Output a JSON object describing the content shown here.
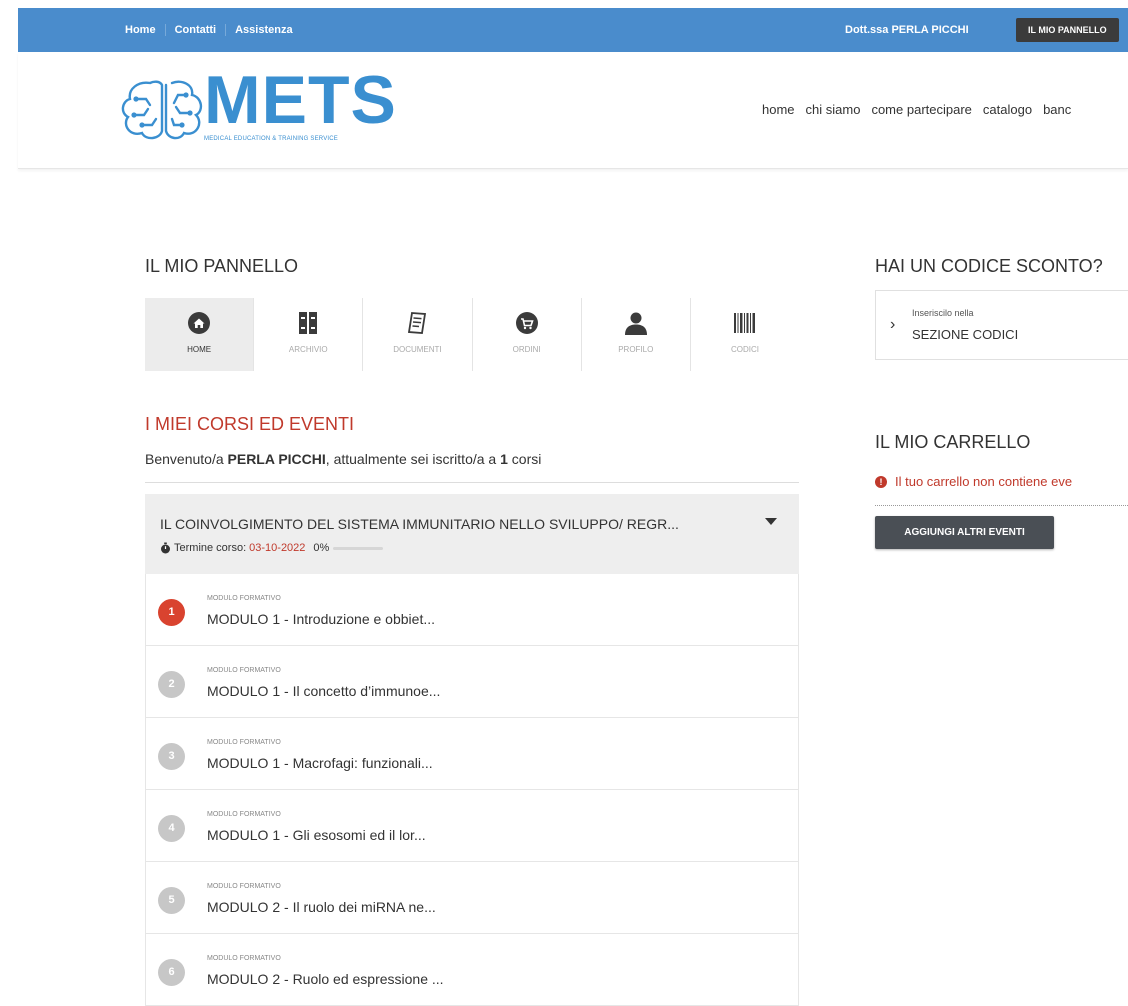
{
  "topbar": {
    "links": [
      "Home",
      "Contatti",
      "Assistenza"
    ],
    "user_name": "Dott.ssa PERLA PICCHI",
    "panel_button": "IL MIO PANNELLO"
  },
  "brand": {
    "name": "METS",
    "tagline": "MEDICAL EDUCATION & TRAINING SERVICE",
    "color": "#3a8fd0"
  },
  "main_nav": [
    "home",
    "chi siamo",
    "come partecipare",
    "catalogo",
    "banc"
  ],
  "panel": {
    "title": "IL MIO PANNELLO",
    "tiles": [
      {
        "label": "HOME",
        "icon": "home-icon",
        "active": true
      },
      {
        "label": "ARCHIVIO",
        "icon": "archive-icon"
      },
      {
        "label": "DOCUMENTI",
        "icon": "document-icon"
      },
      {
        "label": "ORDINI",
        "icon": "cart-icon"
      },
      {
        "label": "PROFILO",
        "icon": "user-icon"
      },
      {
        "label": "CODICI",
        "icon": "barcode-icon"
      }
    ]
  },
  "courses": {
    "title": "I MIEI CORSI ED EVENTI",
    "welcome_prefix": "Benvenuto/a ",
    "welcome_name": "PERLA PICCHI",
    "welcome_mid": ", attualmente sei iscritto/a a ",
    "welcome_count": "1",
    "welcome_suffix": " corsi",
    "course": {
      "name": "IL COINVOLGIMENTO DEL SISTEMA IMMUNITARIO NELLO SVILUPPO/ REGR...",
      "end_label": "Termine corso:",
      "end_date": "03-10-2022",
      "progress_text": "0%",
      "progress": 0
    },
    "modules": [
      {
        "num": "1",
        "kicker": "MODULO FORMATIVO",
        "title": "MODULO 1 - Introduzione e obbiet..."
      },
      {
        "num": "2",
        "kicker": "MODULO FORMATIVO",
        "title": "MODULO 1 - Il concetto d’immunoe..."
      },
      {
        "num": "3",
        "kicker": "MODULO FORMATIVO",
        "title": "MODULO 1 - Macrofagi: funzionali..."
      },
      {
        "num": "4",
        "kicker": "MODULO FORMATIVO",
        "title": "MODULO 1 - Gli esosomi ed il lor..."
      },
      {
        "num": "5",
        "kicker": "MODULO FORMATIVO",
        "title": "MODULO 2 - Il ruolo dei miRNA ne..."
      },
      {
        "num": "6",
        "kicker": "MODULO FORMATIVO",
        "title": "MODULO 2 - Ruolo ed espressione ..."
      }
    ]
  },
  "discount": {
    "title": "HAI UN CODICE SCONTO?",
    "small": "Inseriscilo nella",
    "big": "SEZIONE CODICI"
  },
  "cart": {
    "title": "IL MIO CARRELLO",
    "message": "Il tuo carrello non contiene eve",
    "button": "AGGIUNGI ALTRI EVENTI"
  },
  "colors": {
    "topbar": "#4a8ccc",
    "accent_red": "#c0392b",
    "button_dark": "#4a4f55"
  }
}
